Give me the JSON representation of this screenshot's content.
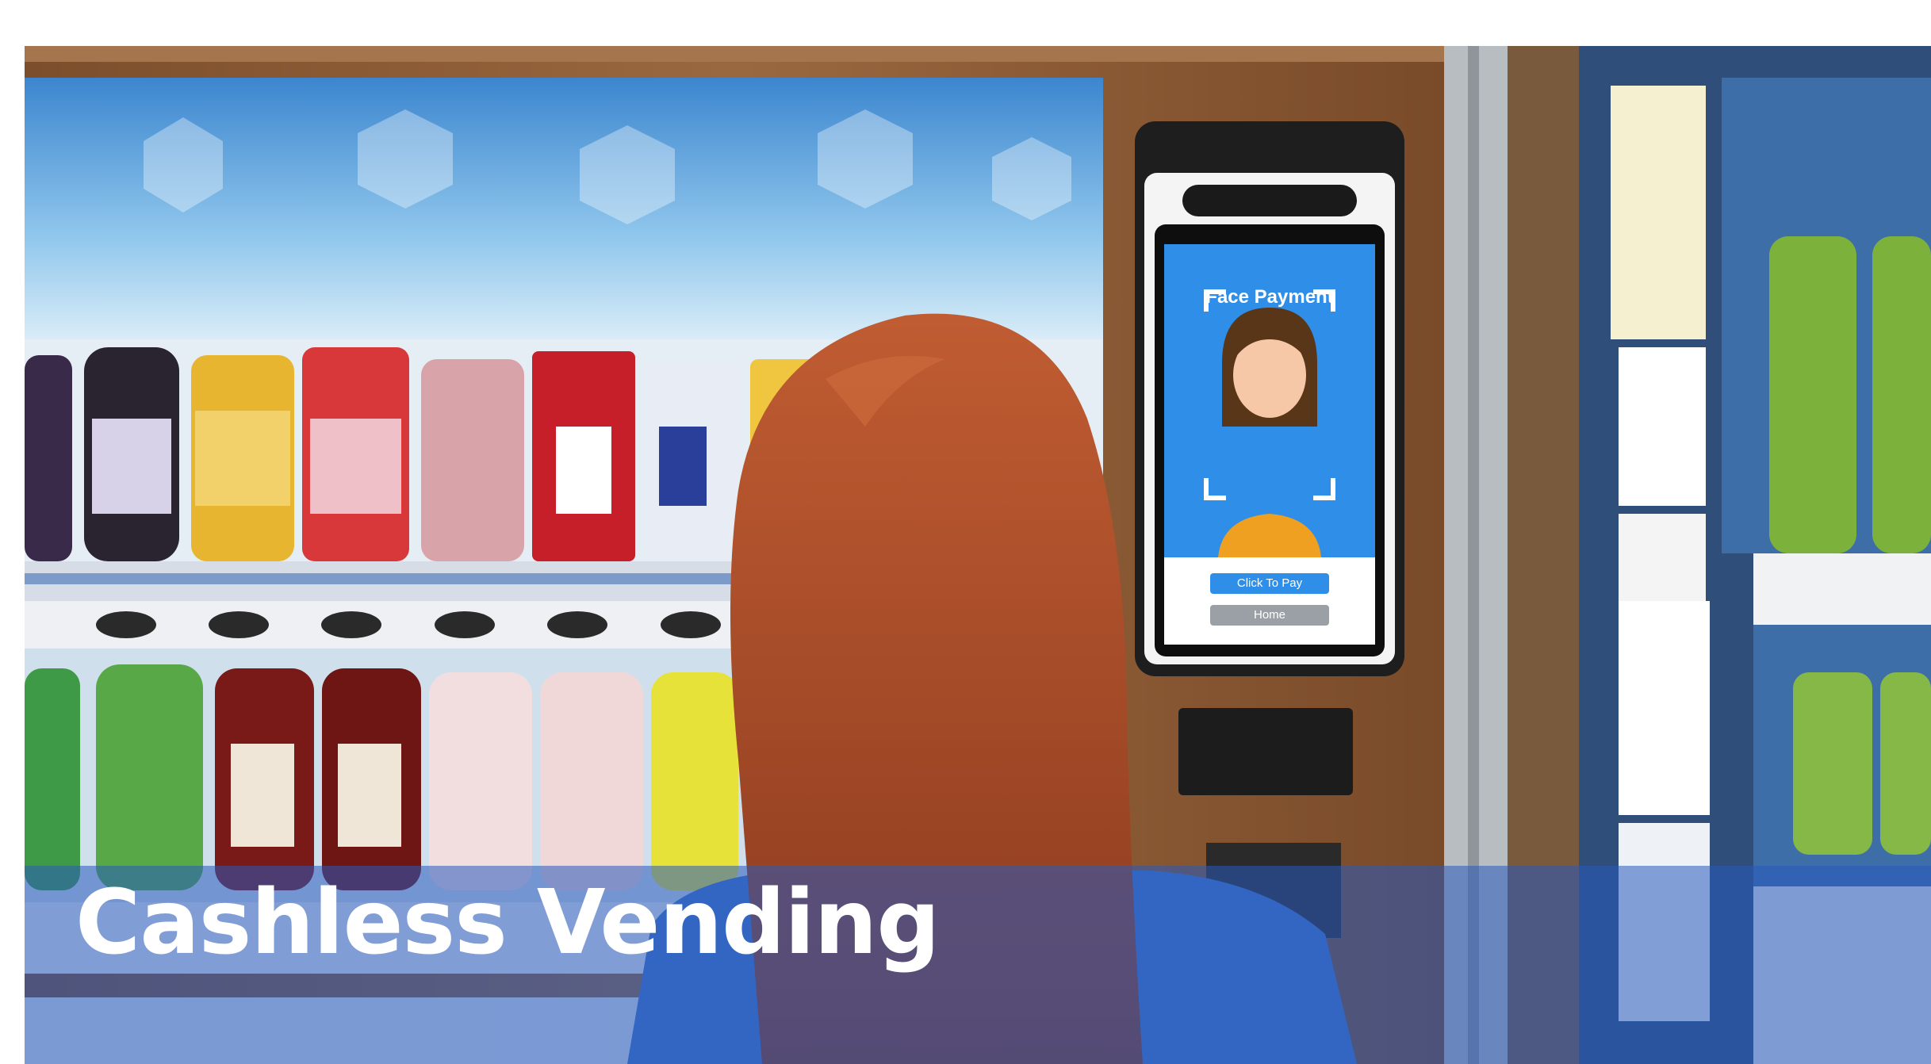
{
  "caption": {
    "title": "Cashless Vending"
  },
  "kiosk": {
    "screen_title": "Face Payment",
    "primary_button": "Click To Pay",
    "secondary_button": "Home"
  },
  "colors": {
    "caption_band": "#285abe",
    "screen_blue": "#2f8fe8",
    "cabinet_brown": "#8a5a34",
    "hair": "#b4552f"
  }
}
